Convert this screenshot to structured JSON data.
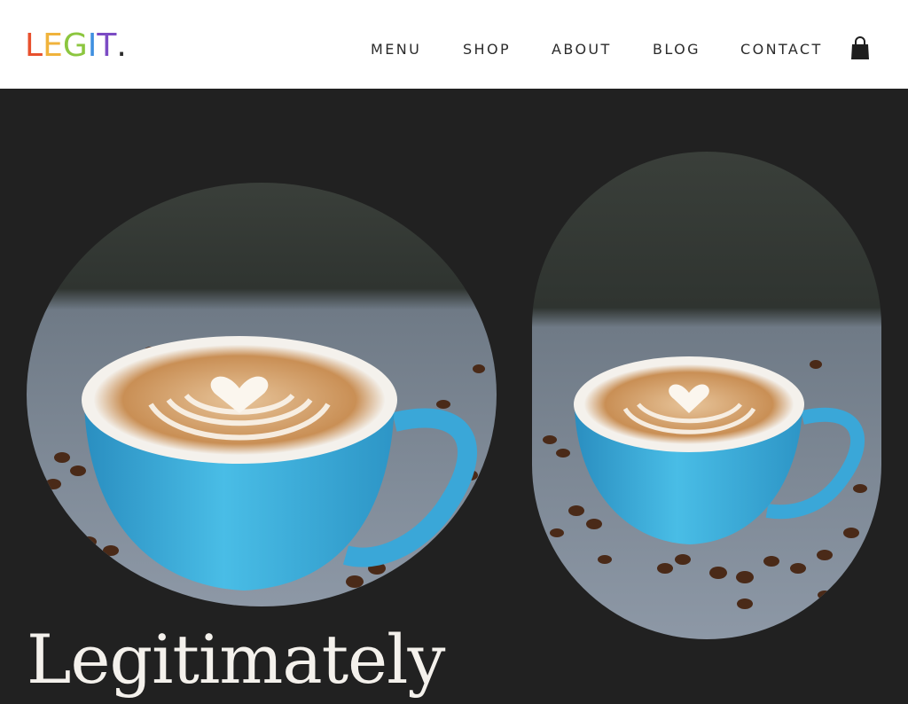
{
  "brand": {
    "letters": [
      {
        "char": "L",
        "color": "#e8502d"
      },
      {
        "char": "E",
        "color": "#f0b33c"
      },
      {
        "char": "G",
        "color": "#8cc63f"
      },
      {
        "char": "I",
        "color": "#3f8fe0"
      },
      {
        "char": "T",
        "color": "#7b4bc4"
      },
      {
        "char": ".",
        "color": "#2b2b2b"
      }
    ]
  },
  "nav": {
    "items": [
      {
        "label": "MENU"
      },
      {
        "label": "SHOP"
      },
      {
        "label": "ABOUT"
      },
      {
        "label": "BLOG"
      },
      {
        "label": "CONTACT"
      }
    ],
    "cart_icon": "shopping-bag-icon"
  },
  "hero": {
    "headline": "Legitimately",
    "images": [
      {
        "subject": "latte-art-blue-cup"
      },
      {
        "subject": "latte-art-blue-cup"
      }
    ]
  },
  "colors": {
    "background": "#212121",
    "header_bg": "#ffffff",
    "nav_text": "#2b2b2b",
    "headline_text": "#f4f1ec",
    "cup_blue": "#3fb0dc"
  }
}
